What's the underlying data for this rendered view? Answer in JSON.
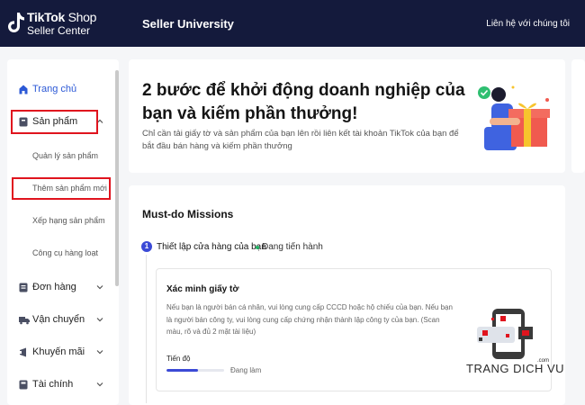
{
  "header": {
    "logo_line1_bold": "TikTok",
    "logo_line1_rest": " Shop",
    "logo_line2": "Seller Center",
    "title": "Seller University",
    "contact_link": "Liên hệ với chúng tôi"
  },
  "sidebar": {
    "items": [
      {
        "label": "Trang chủ",
        "icon": "home-icon",
        "active": true
      },
      {
        "label": "Sản phẩm",
        "icon": "product-icon",
        "expanded": true
      },
      {
        "label": "Đơn hàng",
        "icon": "order-icon"
      },
      {
        "label": "Vận chuyển",
        "icon": "truck-icon"
      },
      {
        "label": "Khuyến mãi",
        "icon": "promo-icon"
      },
      {
        "label": "Tài chính",
        "icon": "finance-icon"
      }
    ],
    "sub_items": [
      "Quản lý sản phẩm",
      "Thêm sản phẩm mới",
      "Xếp hạng sản phẩm",
      "Công cụ hàng loạt"
    ]
  },
  "hero": {
    "title": "2 bước để khởi động doanh nghiệp của bạn và kiếm phần thưởng!",
    "description": "Chỉ cần tải giấy tờ và sản phẩm của bạn lên rồi liên kết tài khoản TikTok của bạn để bắt đầu bán hàng và kiếm phần thưởng"
  },
  "missions": {
    "title": "Must-do Missions",
    "step": {
      "number": "1",
      "label": "Thiết lập cửa hàng của bạn",
      "status": "Đang tiến hành"
    },
    "task": {
      "title": "Xác minh giấy tờ",
      "description": "Nếu bạn là người bán cá nhân, vui lòng cung cấp CCCD hoặc hộ chiếu của bạn. Nếu bạn là người bán công ty, vui lòng cung cấp chứng nhận thành lập công ty của bạn. (Scan màu, rõ và đủ 2 mặt tài liệu)",
      "progress_label": "Tiến độ",
      "progress_status": "Đang làm",
      "progress_fraction": 0.55
    }
  },
  "watermark": {
    "text": "TRANG DICH VU",
    "suffix": ".com"
  },
  "colors": {
    "topbar": "#141a3c",
    "accent": "#3b4ad6",
    "active_link": "#2c59d6",
    "highlight_red": "#e0141e",
    "status_green": "#20b464"
  }
}
